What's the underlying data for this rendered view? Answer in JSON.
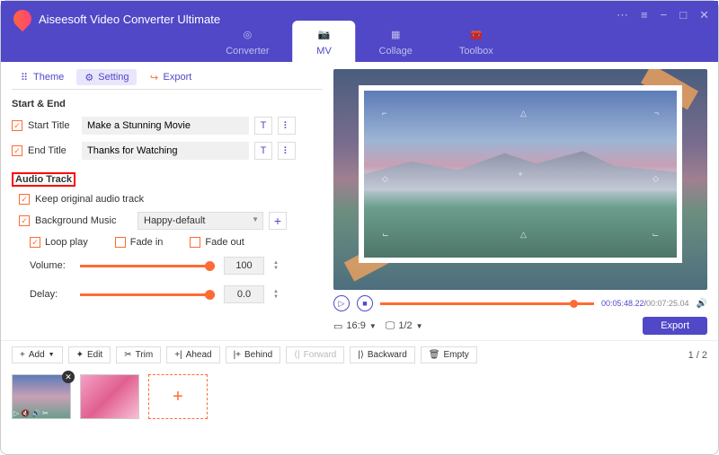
{
  "app": {
    "title": "Aiseesoft Video Converter Ultimate"
  },
  "nav": {
    "converter": "Converter",
    "mv": "MV",
    "collage": "Collage",
    "toolbox": "Toolbox"
  },
  "tabs": {
    "theme": "Theme",
    "setting": "Setting",
    "export": "Export"
  },
  "section": {
    "start_end": "Start & End",
    "audio_track": "Audio Track"
  },
  "start_title": {
    "label": "Start Title",
    "value": "Make a Stunning Movie"
  },
  "end_title": {
    "label": "End Title",
    "value": "Thanks for Watching"
  },
  "audio": {
    "keep_original": "Keep original audio track",
    "bg_music": "Background Music",
    "bg_select": "Happy-default",
    "loop": "Loop play",
    "fade_in": "Fade in",
    "fade_out": "Fade out",
    "volume_label": "Volume:",
    "volume_value": "100",
    "delay_label": "Delay:",
    "delay_value": "0.0"
  },
  "player": {
    "current": "00:05:48.22",
    "duration": "00:07:25.04",
    "aspect": "16:9",
    "page": "1/2"
  },
  "toolbar": {
    "add": "Add",
    "edit": "Edit",
    "trim": "Trim",
    "ahead": "Ahead",
    "behind": "Behind",
    "forward": "Forward",
    "backward": "Backward",
    "empty": "Empty"
  },
  "export_btn": "Export",
  "pager": {
    "current": "1",
    "total": "2"
  }
}
